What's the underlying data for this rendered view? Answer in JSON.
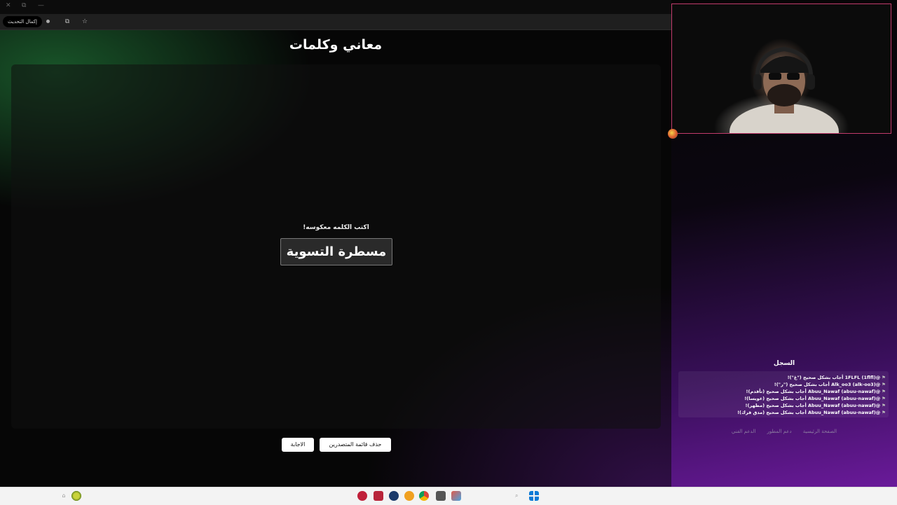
{
  "browser": {
    "update_button": "إكمال التحديث"
  },
  "page": {
    "title": "معاني وكلمات",
    "prompt": "اكتب الكلمه معكوسه!",
    "word": "مسطرة التسوية",
    "buttons": {
      "answer": "الاجابة",
      "clear_leaderboard": "حذف قائمة المتصدرين"
    }
  },
  "log": {
    "title": "السجل",
    "entries": [
      "@(1flfl) 1FLFL أجاب بشكل صحيح (\"غ\")!",
      "@(alk-oo3) Alk_oo3 أجاب بشكل صحيح (\"ر\")!",
      "@(abuu-nawaf) Abuu_Nawaf أجاب بشكل صحيح (تأقدم)!",
      "@(abuu-nawaf) Abuu_Nawaf أجاب بشكل صحيح (عويسا)!",
      "@(abuu-nawaf) Abuu_Nawaf أجاب بشكل صحيح (مظهر)!",
      "@(abuu-nawaf) Abuu_Nawaf أجاب بشكل صحيح (مدق قرك)!"
    ]
  },
  "footer_links": [
    "الصفحة الرئيسية",
    "دعم المطور",
    "الدعم الفني"
  ],
  "colors": {
    "green_glow": "#2a9646",
    "purple_glow": "#6a1a9a",
    "cam_border": "#c23b6c"
  }
}
